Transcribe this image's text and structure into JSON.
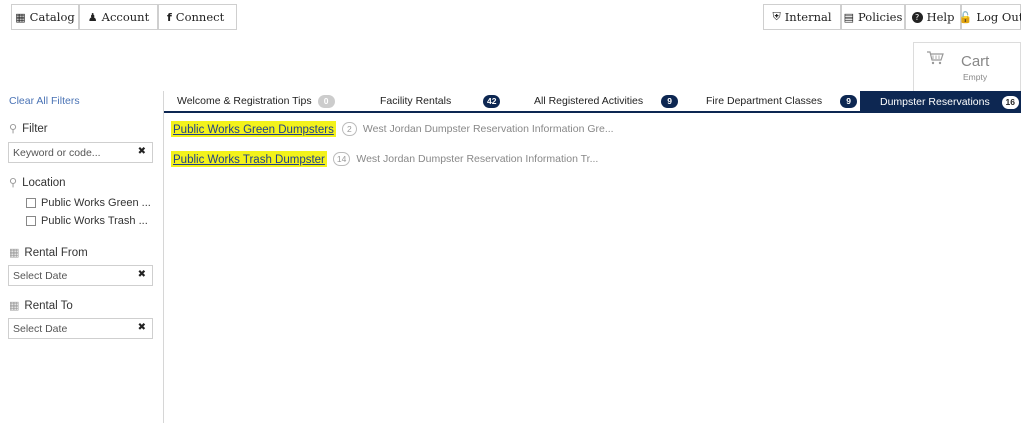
{
  "topnav": {
    "catalog": "Catalog",
    "account": "Account",
    "connect": "Connect",
    "internal": "Internal",
    "policies": "Policies",
    "help": "Help",
    "logout": "Log Out"
  },
  "cart": {
    "title": "Cart",
    "status": "Empty"
  },
  "sidebar": {
    "clear_filters": "Clear All Filters",
    "filter_label": "Filter",
    "filter_placeholder": "Keyword or code...",
    "location_label": "Location",
    "locations": [
      "Public Works Green ...",
      "Public Works Trash ..."
    ],
    "rental_from_label": "Rental From",
    "rental_from_placeholder": "Select Date",
    "rental_to_label": "Rental To",
    "rental_to_placeholder": "Select Date"
  },
  "tabs": [
    {
      "label": "Welcome & Registration Tips",
      "count": "0"
    },
    {
      "label": "Facility Rentals",
      "count": "42"
    },
    {
      "label": "All Registered Activities",
      "count": "9"
    },
    {
      "label": "Fire Department Classes",
      "count": "9"
    },
    {
      "label": "Dumpster Reservations",
      "count": "16"
    }
  ],
  "results": [
    {
      "title": "Public Works Green Dumpsters",
      "count": "2",
      "description": "West Jordan Dumpster Reservation Information Gre..."
    },
    {
      "title": "Public Works Trash Dumpster",
      "count": "14",
      "description": "West Jordan Dumpster Reservation Information Tr..."
    }
  ],
  "colors": {
    "navy": "#0d2752",
    "highlight": "#f3f21b",
    "link": "#1f3f8a",
    "clear_link": "#4a73b5"
  },
  "icons": [
    "grid-icon",
    "user-icon",
    "facebook-icon",
    "shield-icon",
    "document-icon",
    "question-icon",
    "lock-icon",
    "cart-icon",
    "search-icon",
    "map-pin-icon",
    "calendar-icon",
    "clear-icon"
  ]
}
